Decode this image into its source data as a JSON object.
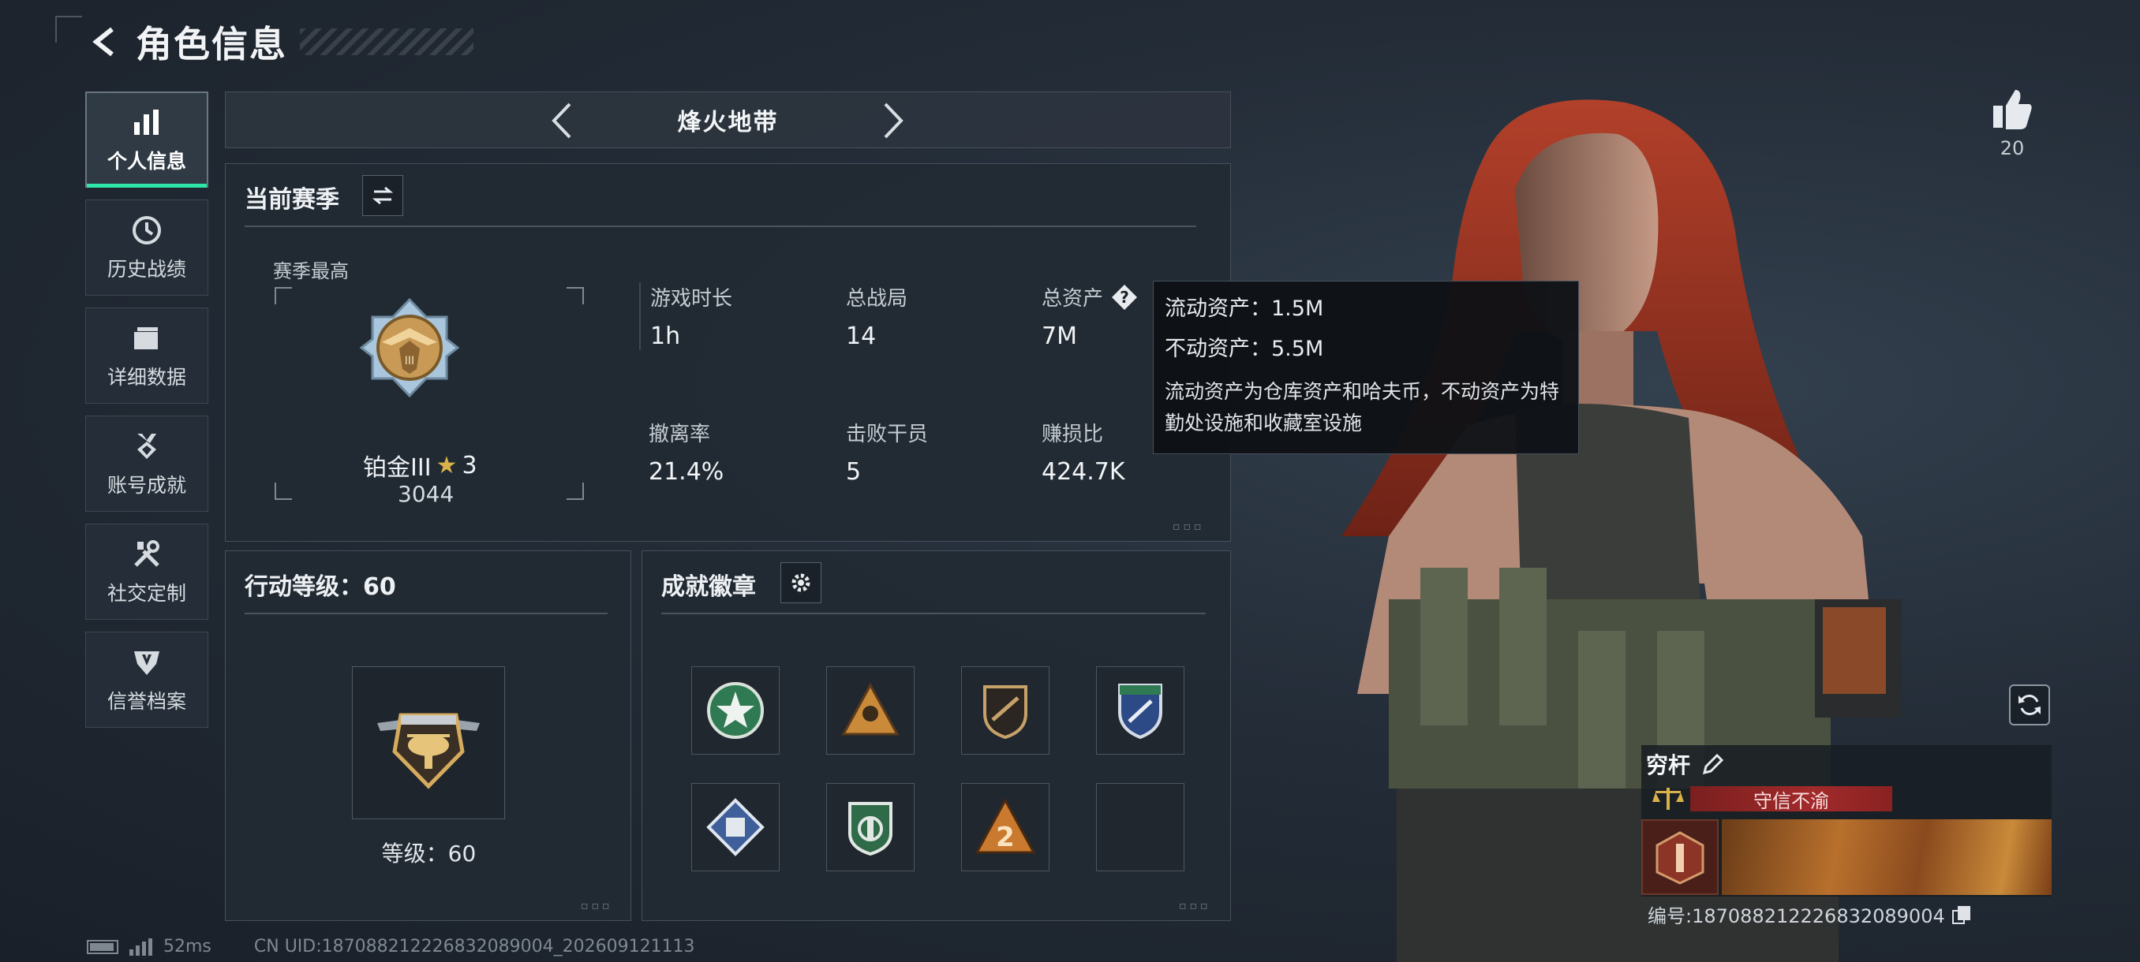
{
  "header": {
    "title": "角色信息"
  },
  "sidebar": {
    "items": [
      {
        "label": "个人信息",
        "icon": "bar-chart-icon",
        "active": true
      },
      {
        "label": "历史战绩",
        "icon": "clock-icon"
      },
      {
        "label": "详细数据",
        "icon": "folder-icon"
      },
      {
        "label": "账号成就",
        "icon": "medal-icon"
      },
      {
        "label": "社交定制",
        "icon": "tools-icon"
      },
      {
        "label": "信誉档案",
        "icon": "reputation-icon"
      }
    ]
  },
  "mode": {
    "title": "烽火地带"
  },
  "season": {
    "title": "当前赛季",
    "best_label": "赛季最高",
    "rank_name": "铂金III",
    "rank_stars": "3",
    "rank_points": "3044",
    "stats": [
      {
        "label": "游戏时长",
        "value": "1h"
      },
      {
        "label": "总战局",
        "value": "14"
      },
      {
        "label": "总资产",
        "value": "7M"
      },
      {
        "label": "撤离率",
        "value": "21.4%"
      },
      {
        "label": "击败干员",
        "value": "5"
      },
      {
        "label": "赚损比",
        "value": "424.7K"
      }
    ]
  },
  "tooltip": {
    "liquid_label": "流动资产：",
    "liquid_value": "1.5M",
    "fixed_label": "不动资产：",
    "fixed_value": "5.5M",
    "description": "流动资产为仓库资产和哈夫币，不动资产为特勤处设施和收藏室设施"
  },
  "level": {
    "title": "行动等级：60",
    "level_label": "等级：60"
  },
  "badges": {
    "title": "成就徽章"
  },
  "character": {
    "name": "穷杆",
    "motto": "守信不渝",
    "uid_label": "编号:187088212226832089004"
  },
  "likes": {
    "count": "20"
  },
  "status": {
    "ping": "52ms",
    "uid_line": "CN UID:187088212226832089004_202609121113"
  },
  "colors": {
    "accent": "#2ee6a8",
    "motto_red": "#a22a2a",
    "bg": "#232c37"
  }
}
